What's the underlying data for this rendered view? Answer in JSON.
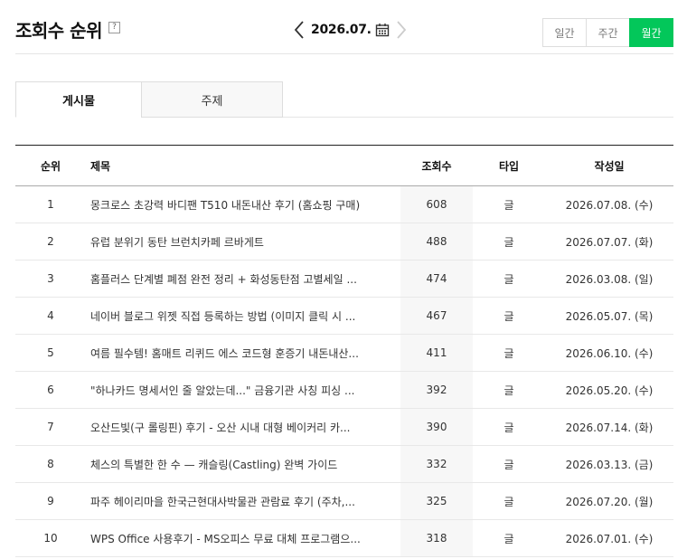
{
  "header": {
    "title": "조회수 순위",
    "help": "?",
    "date": "2026.07.",
    "period_buttons": [
      "일간",
      "주간",
      "월간"
    ],
    "active_period": "월간"
  },
  "tabs": [
    {
      "label": "게시물",
      "active": true
    },
    {
      "label": "주제",
      "active": false
    }
  ],
  "table": {
    "columns": [
      "순위",
      "제목",
      "조회수",
      "타입",
      "작성일"
    ],
    "rows": [
      {
        "rank": "1",
        "title": "몽크로스 초강력 바디팬 T510 내돈내산 후기 (홈쇼핑 구매)",
        "views": "608",
        "type": "글",
        "date": "2026.07.08. (수)"
      },
      {
        "rank": "2",
        "title": "유럽 분위기 동탄 브런치카페 르바게트",
        "views": "488",
        "type": "글",
        "date": "2026.07.07. (화)"
      },
      {
        "rank": "3",
        "title": "홈플러스 단계별 폐점 완전 정리 + 화성동탄점 고별세일 ...",
        "views": "474",
        "type": "글",
        "date": "2026.03.08. (일)"
      },
      {
        "rank": "4",
        "title": "네이버 블로그 위젯 직접 등록하는 방법 (이미지 클릭 시 ...",
        "views": "467",
        "type": "글",
        "date": "2026.05.07. (목)"
      },
      {
        "rank": "5",
        "title": "여름 필수템! 홈매트 리퀴드 에스 코드형 훈증기 내돈내산...",
        "views": "411",
        "type": "글",
        "date": "2026.06.10. (수)"
      },
      {
        "rank": "6",
        "title": "\"하나카드 명세서인 줄 알았는데...\" 금융기관 사칭 피싱 ...",
        "views": "392",
        "type": "글",
        "date": "2026.05.20. (수)"
      },
      {
        "rank": "7",
        "title": "오산드빛(구 롤링핀) 후기 - 오산 시내 대형 베이커리 카...",
        "views": "390",
        "type": "글",
        "date": "2026.07.14. (화)"
      },
      {
        "rank": "8",
        "title": "체스의 특별한 한 수 — 캐슬링(Castling) 완벽 가이드",
        "views": "332",
        "type": "글",
        "date": "2026.03.13. (금)"
      },
      {
        "rank": "9",
        "title": "파주 헤이리마을 한국근현대사박물관 관람료 후기 (주차,...",
        "views": "325",
        "type": "글",
        "date": "2026.07.20. (월)"
      },
      {
        "rank": "10",
        "title": "WPS Office 사용후기 - MS오피스 무료 대체 프로그램으...",
        "views": "318",
        "type": "글",
        "date": "2026.07.01. (수)"
      }
    ]
  },
  "colors": {
    "accent": "#03c75a"
  },
  "icons": {
    "prev": "chevron-left-icon",
    "next": "chevron-right-icon",
    "calendar": "calendar-icon",
    "help": "help-icon"
  }
}
